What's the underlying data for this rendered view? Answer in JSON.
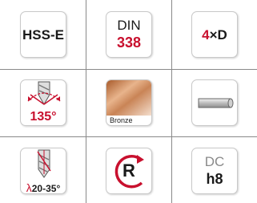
{
  "colors": {
    "accent": "#c8102e",
    "text": "#1a1a1a",
    "muted": "#8a8a8a",
    "grid": "#8a8a8a",
    "bronze": "#c98456"
  },
  "tiles": [
    {
      "name": "material-hss-e",
      "label": "HSS-E"
    },
    {
      "name": "standard-din-338",
      "line1": "DIN",
      "line2": "338"
    },
    {
      "name": "drill-length-4xd",
      "number": "4",
      "suffix": "×D"
    },
    {
      "name": "point-angle-135",
      "icon": "drill-point-angle-icon",
      "label": "135°"
    },
    {
      "name": "material-bronze",
      "icon": "bronze-swatch-icon",
      "label": "Bronze"
    },
    {
      "name": "cylindrical-shank",
      "icon": "cylindrical-shank-icon"
    },
    {
      "name": "helix-angle",
      "icon": "drill-helix-icon",
      "symbol": "λ",
      "label": "20-35°"
    },
    {
      "name": "right-hand-cutting",
      "icon": "right-hand-rotation-icon",
      "label": "R"
    },
    {
      "name": "tolerance-dc-h8",
      "line1": "DC",
      "line2": "h8"
    }
  ]
}
